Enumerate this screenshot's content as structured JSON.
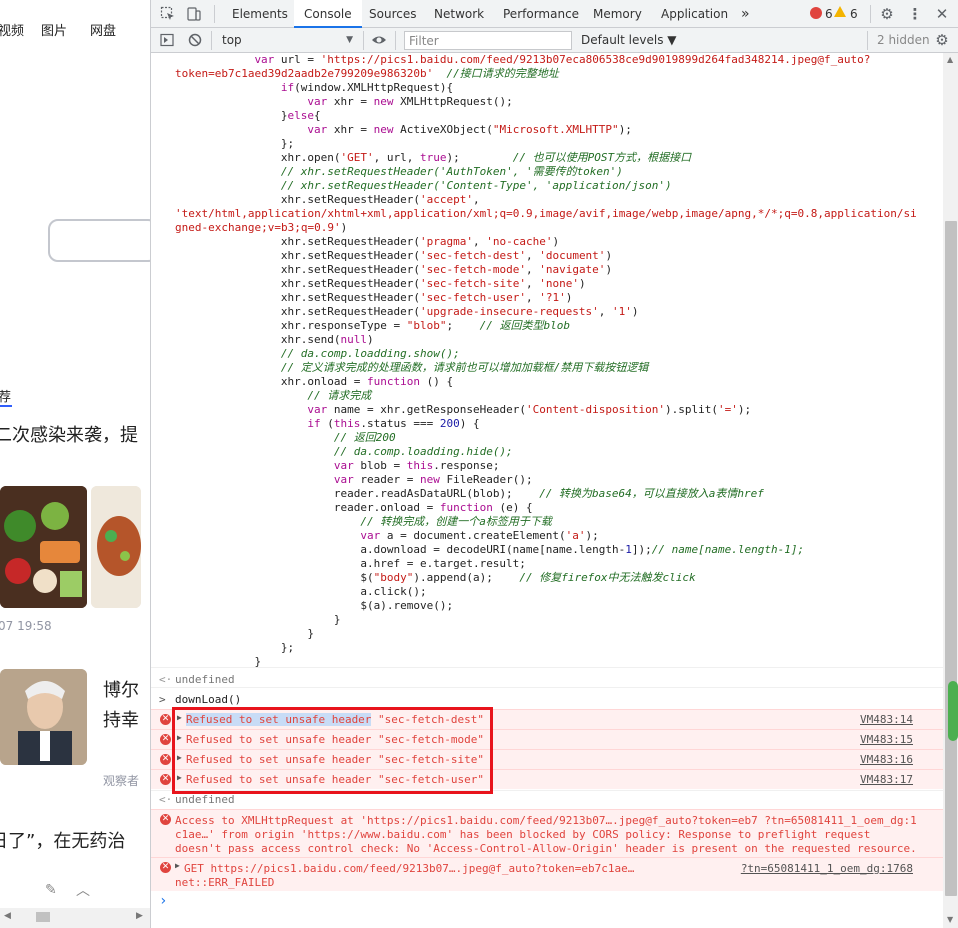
{
  "page": {
    "nav": [
      "视频",
      "图片",
      "网盘"
    ],
    "rec_tab": "荐",
    "headline1": "二次感染来袭，提",
    "pubtime": "07 19:58",
    "headline2": "博尔持幸",
    "source2": "观察者",
    "headline3": "日了”，在无药治"
  },
  "devtools": {
    "tabs": [
      "Elements",
      "Console",
      "Sources",
      "Network",
      "Performance",
      "Memory",
      "Application"
    ],
    "active_tab": "Console",
    "more_tabs": "»",
    "error_count": "6",
    "warning_count": "6",
    "toolbar": {
      "context": "top",
      "filter_placeholder": "Filter",
      "levels": "Default levels ▼",
      "hidden": "2 hidden"
    }
  },
  "console": {
    "code_lines": [
      {
        "indent": 12,
        "html": "<span class=\"kw\">var</span> url = <span class=\"str\">'https://pics1.baidu.com/feed/9213b07eca806538ce9d9019899d264fad348214.jpeg@f_auto?</span>"
      },
      {
        "indent": 0,
        "html": "<span class=\"str\">token=eb7c1aed39d2aadb2e799209e986320b'</span>  <span class=\"cmt\">//接口请求的完整地址</span>"
      },
      {
        "indent": 16,
        "html": "<span class=\"kw\">if</span>(window.XMLHttpRequest){"
      },
      {
        "indent": 20,
        "html": "<span class=\"kw\">var</span> xhr = <span class=\"kw\">new</span> XMLHttpRequest();"
      },
      {
        "indent": 16,
        "html": "}<span class=\"kw\">else</span>{"
      },
      {
        "indent": 20,
        "html": "<span class=\"kw\">var</span> xhr = <span class=\"kw\">new</span> ActiveXObject(<span class=\"str\">\"Microsoft.XMLHTTP\"</span>);"
      },
      {
        "indent": 16,
        "html": "};"
      },
      {
        "indent": 16,
        "html": "xhr.open(<span class=\"str\">'GET'</span>, url, <span class=\"kw\">true</span>);        <span class=\"cmt\">// 也可以使用POST方式，根据接口</span>"
      },
      {
        "indent": 16,
        "html": "<span class=\"cmt\">// xhr.setRequestHeader('AuthToken', '需要传的token')</span>"
      },
      {
        "indent": 16,
        "html": "<span class=\"cmt\">// xhr.setRequestHeader('Content-Type', 'application/json')</span>"
      },
      {
        "indent": 16,
        "html": "xhr.setRequestHeader(<span class=\"str\">'accept'</span>,"
      },
      {
        "indent": 0,
        "html": "<span class=\"str\">'text/html,application/xhtml+xml,application/xml;q=0.9,image/avif,image/webp,image/apng,*/*;q=0.8,application/si</span>"
      },
      {
        "indent": 0,
        "html": "<span class=\"str\">gned-exchange;v=b3;q=0.9'</span>)"
      },
      {
        "indent": 16,
        "html": "xhr.setRequestHeader(<span class=\"str\">'pragma'</span>, <span class=\"str\">'no-cache'</span>)"
      },
      {
        "indent": 16,
        "html": "xhr.setRequestHeader(<span class=\"str\">'sec-fetch-dest'</span>, <span class=\"str\">'document'</span>)"
      },
      {
        "indent": 16,
        "html": "xhr.setRequestHeader(<span class=\"str\">'sec-fetch-mode'</span>, <span class=\"str\">'navigate'</span>)"
      },
      {
        "indent": 16,
        "html": "xhr.setRequestHeader(<span class=\"str\">'sec-fetch-site'</span>, <span class=\"str\">'none'</span>)"
      },
      {
        "indent": 16,
        "html": "xhr.setRequestHeader(<span class=\"str\">'sec-fetch-user'</span>, <span class=\"str\">'?1'</span>)"
      },
      {
        "indent": 16,
        "html": "xhr.setRequestHeader(<span class=\"str\">'upgrade-insecure-requests'</span>, <span class=\"str\">'1'</span>)"
      },
      {
        "indent": 16,
        "html": "xhr.responseType = <span class=\"str\">\"blob\"</span>;    <span class=\"cmt\">// 返回类型blob</span>"
      },
      {
        "indent": 16,
        "html": "xhr.send(<span class=\"kw\">null</span>)"
      },
      {
        "indent": 16,
        "html": "<span class=\"cmt\">// da.comp.loadding.show();</span>"
      },
      {
        "indent": 16,
        "html": "<span class=\"cmt\">// 定义请求完成的处理函数，请求前也可以增加加载框/禁用下载按钮逻辑</span>"
      },
      {
        "indent": 16,
        "html": "xhr.onload = <span class=\"kw\">function</span> () {"
      },
      {
        "indent": 20,
        "html": "<span class=\"cmt\">// 请求完成</span>"
      },
      {
        "indent": 20,
        "html": "<span class=\"kw\">var</span> name = xhr.getResponseHeader(<span class=\"str\">'Content-disposition'</span>).split(<span class=\"str\">'='</span>);"
      },
      {
        "indent": 20,
        "html": "<span class=\"kw\">if</span> (<span class=\"kw\">this</span>.status === <span class=\"fn\">200</span>) {"
      },
      {
        "indent": 24,
        "html": "<span class=\"cmt\">// 返回200</span>"
      },
      {
        "indent": 24,
        "html": "<span class=\"cmt\">// da.comp.loadding.hide();</span>"
      },
      {
        "indent": 24,
        "html": "<span class=\"kw\">var</span> blob = <span class=\"kw\">this</span>.response;"
      },
      {
        "indent": 24,
        "html": "<span class=\"kw\">var</span> reader = <span class=\"kw\">new</span> FileReader();"
      },
      {
        "indent": 24,
        "html": "reader.readAsDataURL(blob);    <span class=\"cmt\">// 转换为base64，可以直接放入a表情href</span>"
      },
      {
        "indent": 24,
        "html": "reader.onload = <span class=\"kw\">function</span> (e) {"
      },
      {
        "indent": 28,
        "html": "<span class=\"cmt\">// 转换完成，创建一个a标签用于下载</span>"
      },
      {
        "indent": 28,
        "html": "<span class=\"kw\">var</span> a = document.createElement(<span class=\"str\">'a'</span>);"
      },
      {
        "indent": 28,
        "html": "a.download = decodeURI(name[name.length-<span class=\"fn\">1</span>]);<span class=\"cmt\">// name[name.length-1];</span>"
      },
      {
        "indent": 28,
        "html": "a.href = e.target.result;"
      },
      {
        "indent": 28,
        "html": "$(<span class=\"str\">\"body\"</span>).append(a);    <span class=\"cmt\">// 修复firefox中无法触发click</span>"
      },
      {
        "indent": 28,
        "html": "a.click();"
      },
      {
        "indent": 28,
        "html": "$(a).remove();"
      },
      {
        "indent": 24,
        "html": "}"
      },
      {
        "indent": 20,
        "html": "}"
      },
      {
        "indent": 16,
        "html": "};"
      },
      {
        "indent": 12,
        "html": "}"
      }
    ],
    "result1": "undefined",
    "input_call": "downLoad()",
    "errors": [
      {
        "msg": "Refused to set unsafe header \"sec-fetch-dest\"",
        "src": "VM483:14"
      },
      {
        "msg": "Refused to set unsafe header \"sec-fetch-mode\"",
        "src": "VM483:15"
      },
      {
        "msg": "Refused to set unsafe header \"sec-fetch-site\"",
        "src": "VM483:16"
      },
      {
        "msg": "Refused to set unsafe header \"sec-fetch-user\"",
        "src": "VM483:17"
      }
    ],
    "result2": "undefined",
    "cors_error": [
      "Access to XMLHttpRequest at 'https://pics1.baidu.com/feed/9213b07….jpeg@f_auto?token=eb7 ?tn=65081411_1_oem_dg:1",
      "c1ae…' from origin 'https://www.baidu.com' has been blocked by CORS policy: Response to preflight request",
      "doesn't pass access control check: No 'Access-Control-Allow-Origin' header is present on the requested resource."
    ],
    "get_error": {
      "line1": "GET https://pics1.baidu.com/feed/9213b07….jpeg@f_auto?token=eb7c1ae…",
      "src": "?tn=65081411_1_oem_dg:1768",
      "line2": "net::ERR_FAILED"
    },
    "prompt": "›"
  }
}
